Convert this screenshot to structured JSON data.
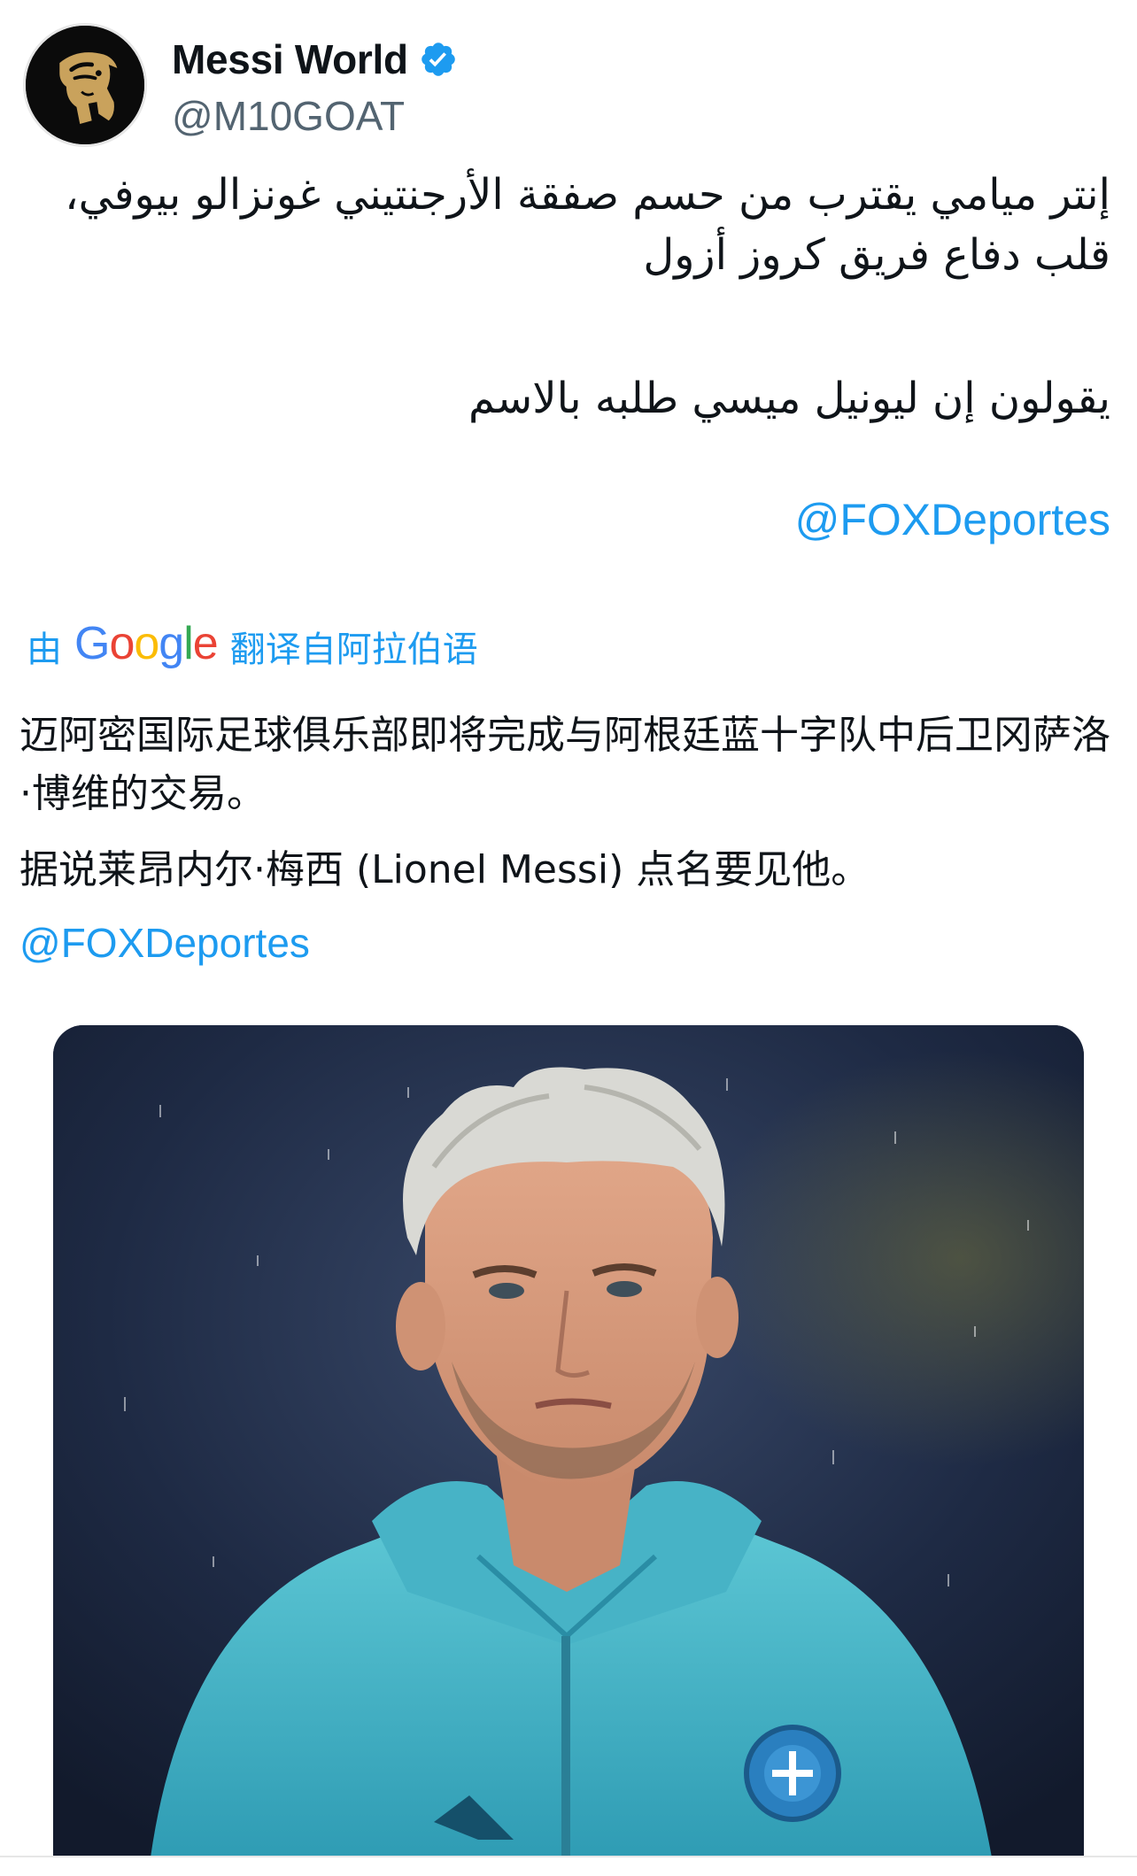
{
  "author": {
    "display_name": "Messi World",
    "handle": "@M10GOAT",
    "verified": true,
    "avatar_icon": "golden-goat-logo"
  },
  "tweet_original": {
    "paragraph1": "إنتر ميامي يقترب من حسم صفقة الأرجنتيني غونزالو بيوفي، قلب دفاع فريق كروز أزول",
    "paragraph2": "يقولون إن ليونيل ميسي طلبه بالاسم",
    "mention": "@FOXDeportes"
  },
  "translation": {
    "prefix": "由",
    "google_letters": [
      "G",
      "o",
      "o",
      "g",
      "l",
      "e"
    ],
    "suffix": "翻译自阿拉伯语",
    "paragraph1": "迈阿密国际足球俱乐部即将完成与阿根廷蓝十字队中后卫冈萨洛·博维的交易。",
    "paragraph2": "据说莱昂内尔·梅西 (Lionel Messi) 点名要见他。",
    "mention": "@FOXDeportes"
  },
  "colors": {
    "link": "#1d9bf0",
    "verified_badge": "#1d9bf0",
    "text": "#0f1419",
    "handle": "#536471"
  },
  "media": {
    "type": "photo",
    "subject": "player-portrait"
  }
}
